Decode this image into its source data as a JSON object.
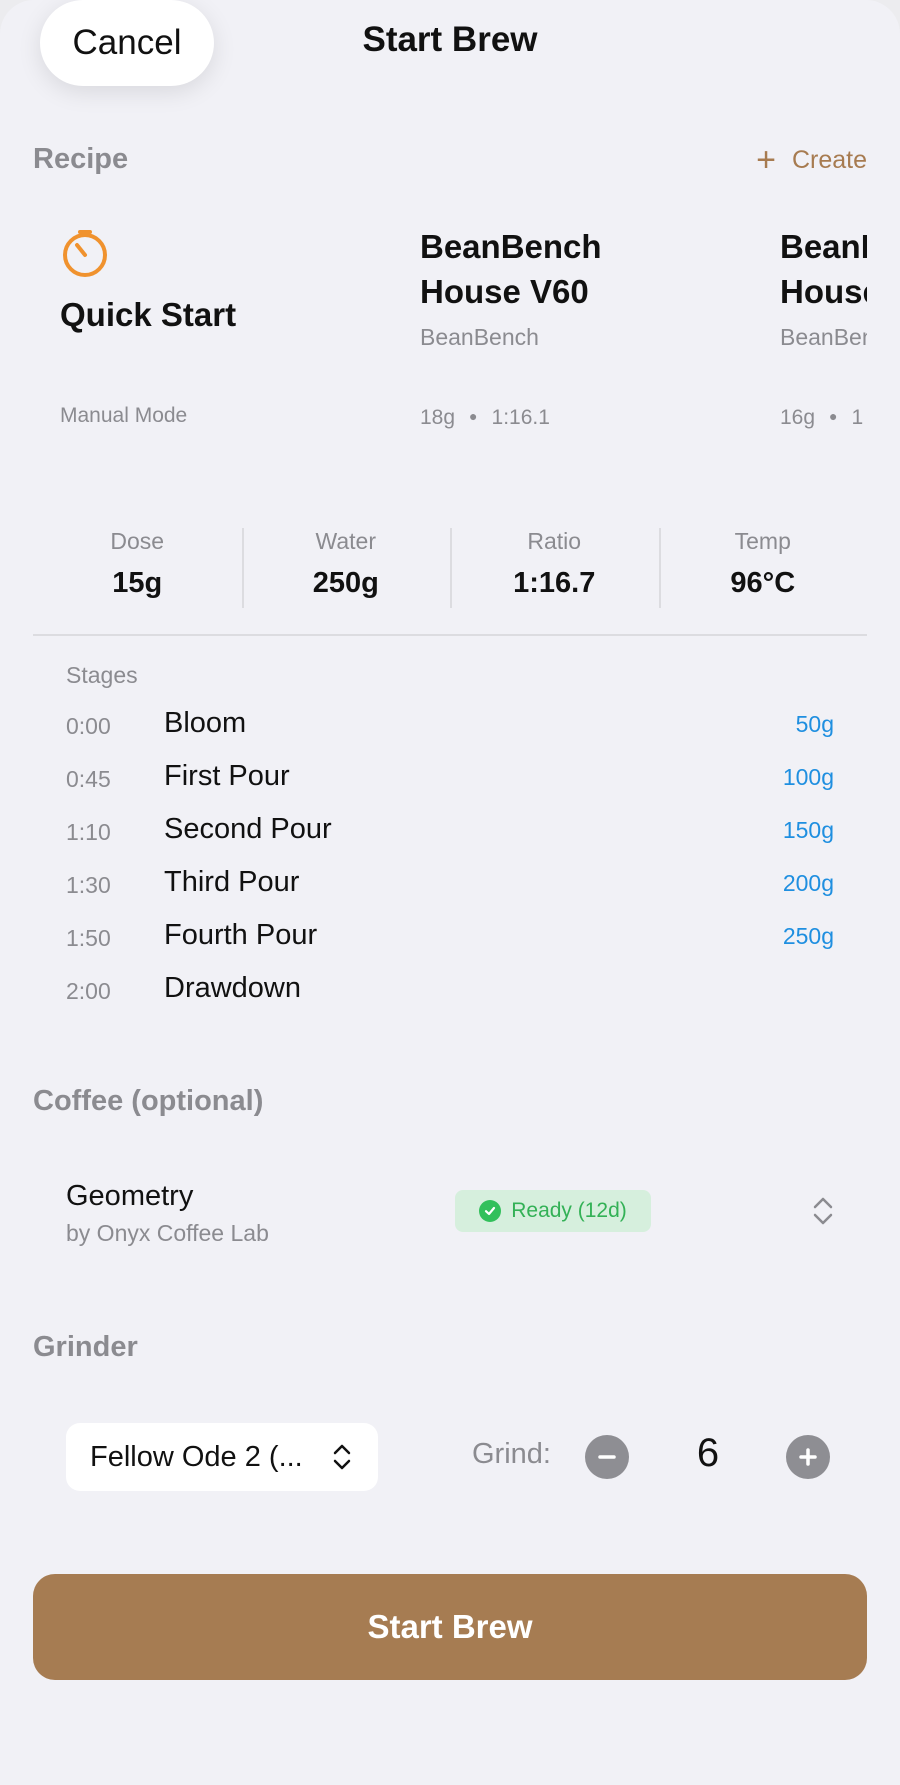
{
  "header": {
    "cancel_label": "Cancel",
    "title": "Start Brew"
  },
  "recipe_section": {
    "label": "Recipe",
    "create_label": "Create",
    "cards": [
      {
        "title": "Quick Start",
        "subtitle": "",
        "meta": "Manual Mode",
        "icon": "timer-icon",
        "icon_color": "#f0922e"
      },
      {
        "title_line1": "BeanBench",
        "title_line2": "House V60",
        "subtitle": "BeanBench",
        "dose": "18g",
        "ratio": "1:16.1"
      },
      {
        "title_line1": "BeanBench",
        "title_line2": "House",
        "subtitle": "BeanBench",
        "dose": "16g",
        "ratio": "1"
      }
    ]
  },
  "stats": [
    {
      "label": "Dose",
      "value": "15g"
    },
    {
      "label": "Water",
      "value": "250g"
    },
    {
      "label": "Ratio",
      "value": "1:16.7"
    },
    {
      "label": "Temp",
      "value": "96°C"
    }
  ],
  "stages": {
    "label": "Stages",
    "rows": [
      {
        "time": "0:00",
        "name": "Bloom",
        "weight": "50g"
      },
      {
        "time": "0:45",
        "name": "First Pour",
        "weight": "100g"
      },
      {
        "time": "1:10",
        "name": "Second Pour",
        "weight": "150g"
      },
      {
        "time": "1:30",
        "name": "Third Pour",
        "weight": "200g"
      },
      {
        "time": "1:50",
        "name": "Fourth Pour",
        "weight": "250g"
      },
      {
        "time": "2:00",
        "name": "Drawdown",
        "weight": ""
      }
    ]
  },
  "coffee": {
    "label": "Coffee (optional)",
    "name": "Geometry",
    "roaster": "by Onyx Coffee Lab",
    "status": "Ready (12d)"
  },
  "grinder": {
    "label": "Grinder",
    "selected": "Fellow Ode 2 (...",
    "grind_label": "Grind:",
    "grind_value": "6"
  },
  "start_button_label": "Start Brew",
  "colors": {
    "accent": "#a67c52",
    "link_blue": "#1f8fe0",
    "ready_green": "#33b156",
    "timer_orange": "#f0922e"
  }
}
